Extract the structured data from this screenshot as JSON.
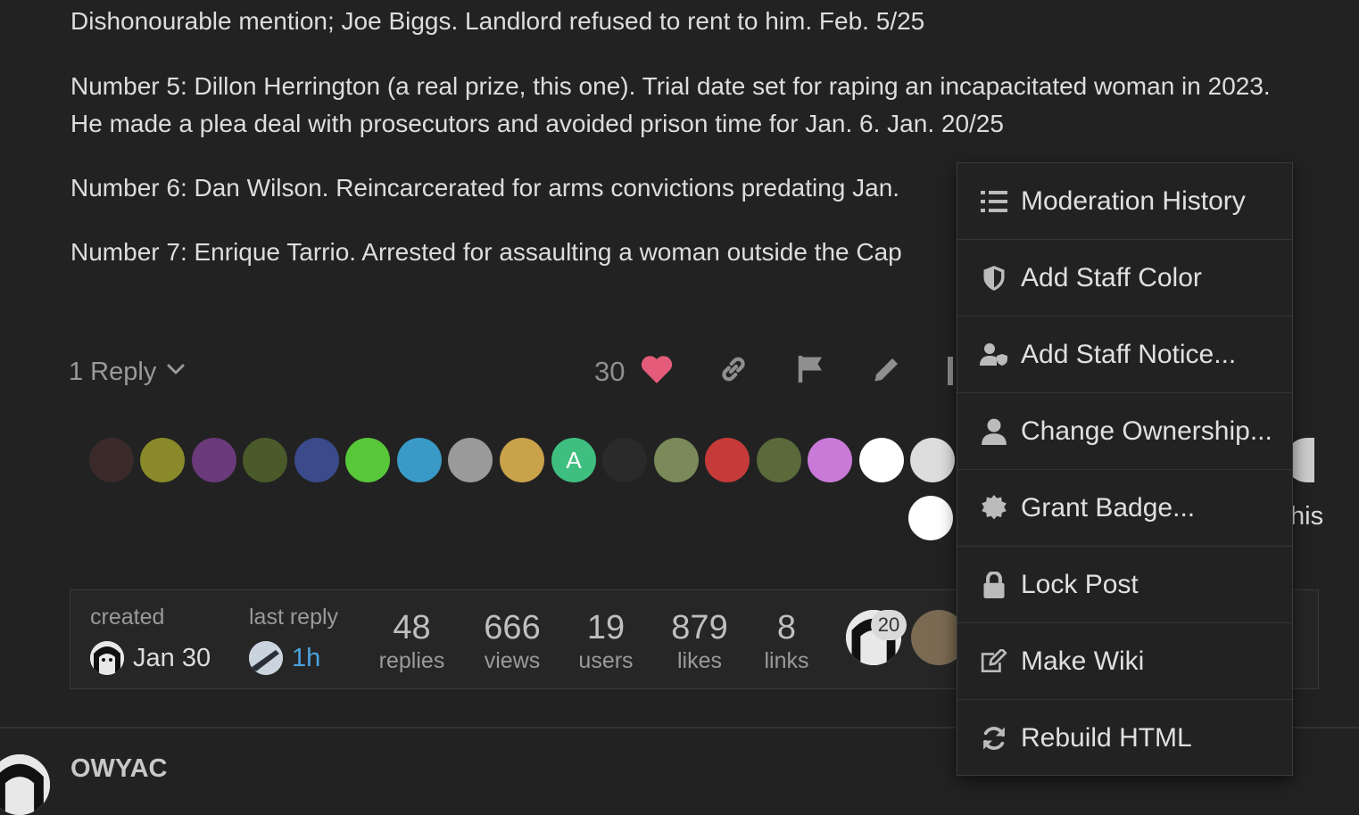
{
  "post": {
    "paragraphs": [
      "Dishonourable mention; Joe Biggs. Landlord refused to rent to him. Feb. 5/25",
      "Number 5: Dillon Herrington (a real prize, this one). Trial date set for raping an incapacitated woman in 2023. He made a plea deal with prosecutors and avoided prison time for Jan. 6. Jan. 20/25",
      "Number 6: Dan Wilson. Reincarcerated for arms convictions predating Jan.",
      "Number 7: Enrique Tarrio. Arrested for assaulting a woman outside the Cap"
    ],
    "reply_toggle": "1 Reply",
    "like_count": "30",
    "trailing_partial_text": "his"
  },
  "liker_avatars": [
    {
      "name": "avatar-1",
      "color": "#3a2a2a"
    },
    {
      "name": "avatar-2",
      "color": "#8a8a2a"
    },
    {
      "name": "avatar-3",
      "color": "#6a3a7a"
    },
    {
      "name": "avatar-4",
      "color": "#4a5a2a"
    },
    {
      "name": "avatar-5",
      "color": "#3a4a8a"
    },
    {
      "name": "avatar-6",
      "color": "#58c73a"
    },
    {
      "name": "avatar-7",
      "color": "#3a9ac7"
    },
    {
      "name": "avatar-8",
      "color": "#9a9a9a"
    },
    {
      "name": "avatar-9",
      "color": "#c9a24a"
    },
    {
      "name": "avatar-10",
      "color": "#3fbf7f",
      "letter": "A"
    },
    {
      "name": "avatar-11",
      "color": "#2a2a2a"
    },
    {
      "name": "avatar-12",
      "color": "#7a8a5a"
    },
    {
      "name": "avatar-13",
      "color": "#c73a3a"
    },
    {
      "name": "avatar-14",
      "color": "#5a6a3a"
    },
    {
      "name": "avatar-15",
      "color": "#c97ad9"
    },
    {
      "name": "avatar-16",
      "color": "#ffffff"
    },
    {
      "name": "avatar-17",
      "color": "#dddddd"
    },
    {
      "name": "avatar-18",
      "color": "#ffffff"
    }
  ],
  "topic_map": {
    "created_label": "created",
    "created_date": "Jan 30",
    "last_reply_label": "last reply",
    "last_reply_time": "1h",
    "stats": [
      {
        "num": "48",
        "label": "replies"
      },
      {
        "num": "666",
        "label": "views"
      },
      {
        "num": "19",
        "label": "users"
      },
      {
        "num": "879",
        "label": "likes"
      },
      {
        "num": "8",
        "label": "links"
      }
    ],
    "participant_badge": "20"
  },
  "next_post": {
    "username": "OWYAC"
  },
  "admin_menu": {
    "items": [
      {
        "label": "Moderation History",
        "icon": "list-icon"
      },
      {
        "label": "Add Staff Color",
        "icon": "shield-icon"
      },
      {
        "label": "Add Staff Notice...",
        "icon": "user-shield-icon"
      },
      {
        "label": "Change Ownership...",
        "icon": "user-icon"
      },
      {
        "label": "Grant Badge...",
        "icon": "certificate-icon"
      },
      {
        "label": "Lock Post",
        "icon": "lock-icon"
      },
      {
        "label": "Make Wiki",
        "icon": "edit-icon"
      },
      {
        "label": "Rebuild HTML",
        "icon": "sync-icon"
      }
    ]
  },
  "colors": {
    "background": "#222222",
    "heart": "#e45c7a",
    "link": "#4aa3df"
  }
}
